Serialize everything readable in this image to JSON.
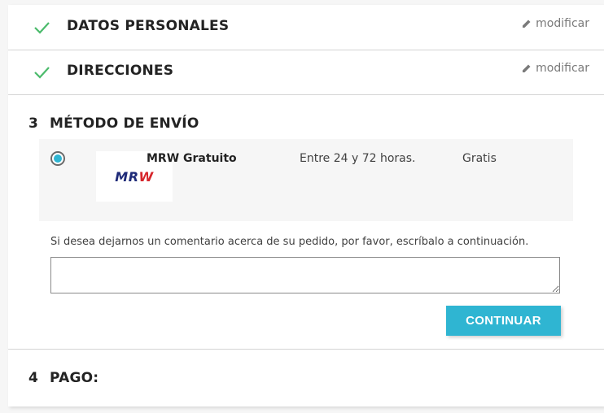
{
  "checkout": {
    "personal": {
      "title": "DATOS PERSONALES",
      "edit": "modificar"
    },
    "addresses": {
      "title": "DIRECCIONES",
      "edit": "modificar"
    },
    "shipping": {
      "number": "3",
      "title": "MÉTODO DE ENVÍO",
      "carrier": {
        "name": "MRW Gratuito",
        "delay": "Entre 24 y 72 horas.",
        "price": "Gratis",
        "logo_text": "MR",
        "logo_text_accent": "W",
        "selected": true
      },
      "comment_label": "Si desea dejarnos un comentario acerca de su pedido, por favor, escríbalo a continuación.",
      "comment_value": "",
      "continue_label": "CONTINUAR"
    },
    "payment": {
      "number": "4",
      "title": "PAGO:"
    }
  },
  "colors": {
    "accent": "#2fb5d2",
    "check": "#4cbb6c"
  },
  "icons": {
    "check": "checkmark-icon",
    "edit": "pencil-icon"
  }
}
